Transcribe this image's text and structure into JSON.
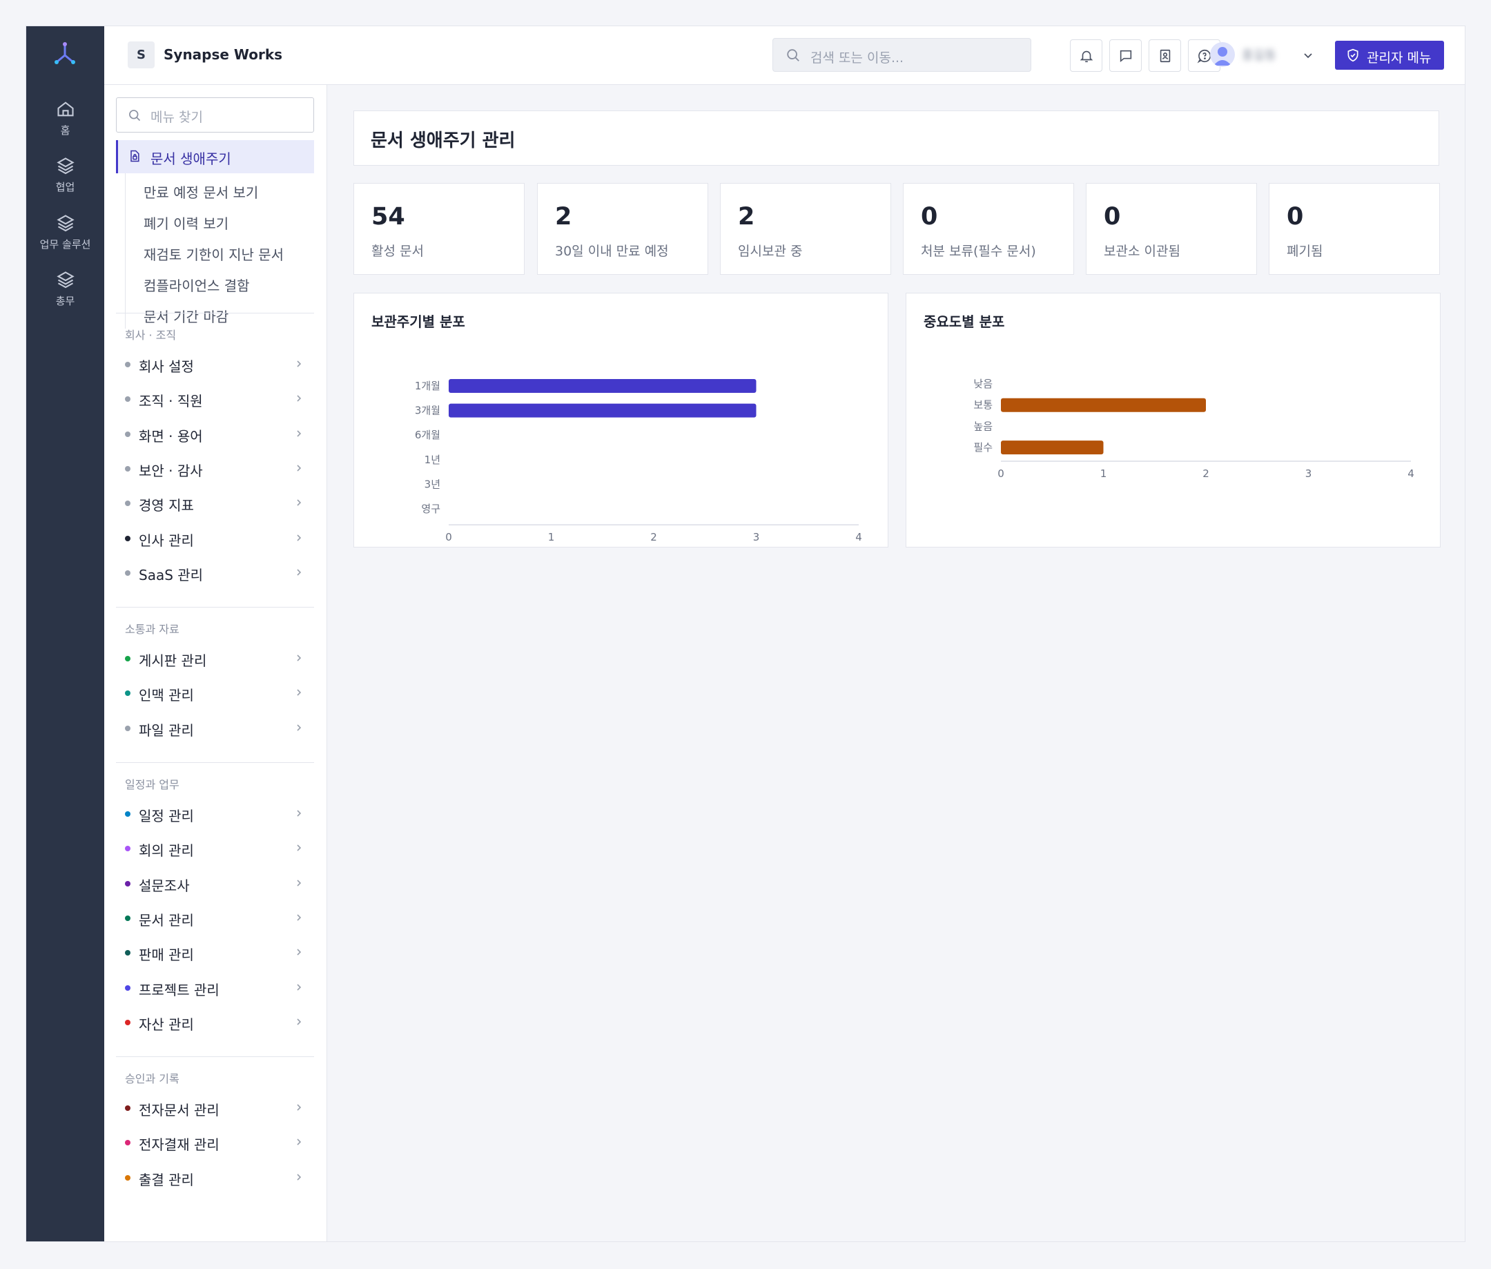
{
  "app": {
    "workspace_initial": "S",
    "workspace_name": "Synapse Works",
    "search_placeholder": "검색 또는 이동...",
    "admin_button": "관리자 메뉴",
    "user_name": "홍길동"
  },
  "rail": {
    "items": [
      {
        "label": "홈",
        "icon": "home-icon"
      },
      {
        "label": "협업",
        "icon": "layers-icon"
      },
      {
        "label": "업무 솔루션",
        "icon": "layers-icon"
      },
      {
        "label": "총무",
        "icon": "layers-icon"
      }
    ]
  },
  "sidebar": {
    "search_placeholder": "메뉴 찾기",
    "active": "문서 생애주기",
    "sub_items": [
      "만료 예정 문서 보기",
      "폐기 이력 보기",
      "재검토 기한이 지난 문서",
      "컴플라이언스 결함",
      "문서 기간 마감"
    ],
    "sections": [
      {
        "title": "회사 · 조직",
        "items": [
          {
            "label": "회사 설정",
            "color": "#9aa1ad"
          },
          {
            "label": "조직 · 직원",
            "color": "#9aa1ad"
          },
          {
            "label": "화면 · 용어",
            "color": "#9aa1ad"
          },
          {
            "label": "보안 · 감사",
            "color": "#9aa1ad"
          },
          {
            "label": "경영 지표",
            "color": "#9aa1ad"
          },
          {
            "label": "인사 관리",
            "color": "#1f2433"
          },
          {
            "label": "SaaS 관리",
            "color": "#9aa1ad"
          }
        ]
      },
      {
        "title": "소통과 자료",
        "items": [
          {
            "label": "게시판 관리",
            "color": "#16a34a"
          },
          {
            "label": "인맥 관리",
            "color": "#0d9488"
          },
          {
            "label": "파일 관리",
            "color": "#9aa1ad"
          }
        ]
      },
      {
        "title": "일정과 업무",
        "items": [
          {
            "label": "일정 관리",
            "color": "#0284c7"
          },
          {
            "label": "회의 관리",
            "color": "#a855f7"
          },
          {
            "label": "설문조사",
            "color": "#6b21a8"
          },
          {
            "label": "문서 관리",
            "color": "#047857"
          },
          {
            "label": "판매 관리",
            "color": "#115e59"
          },
          {
            "label": "프로젝트 관리",
            "color": "#4f46e5"
          },
          {
            "label": "자산 관리",
            "color": "#dc2626"
          }
        ]
      },
      {
        "title": "승인과 기록",
        "items": [
          {
            "label": "전자문서 관리",
            "color": "#7f1d1d"
          },
          {
            "label": "전자결재 관리",
            "color": "#db2777"
          },
          {
            "label": "출결 관리",
            "color": "#d97706"
          }
        ]
      }
    ]
  },
  "main": {
    "page_title": "문서 생애주기 관리",
    "stats": [
      {
        "value": "54",
        "label": "활성 문서"
      },
      {
        "value": "2",
        "label": "30일 이내 만료 예정"
      },
      {
        "value": "2",
        "label": "임시보관 중"
      },
      {
        "value": "0",
        "label": "처분 보류(필수 문서)"
      },
      {
        "value": "0",
        "label": "보관소 이관됨"
      },
      {
        "value": "0",
        "label": "폐기됨"
      }
    ]
  },
  "chart_data": [
    {
      "type": "bar",
      "orientation": "horizontal",
      "title": "보관주기별 분포",
      "categories": [
        "1개월",
        "3개월",
        "6개월",
        "1년",
        "3년",
        "영구"
      ],
      "values": [
        3,
        3,
        0,
        0,
        0,
        0
      ],
      "xlim": [
        0,
        4
      ],
      "xticks": [
        0,
        1,
        2,
        3,
        4
      ],
      "color": "#4338ca"
    },
    {
      "type": "bar",
      "orientation": "horizontal",
      "title": "중요도별 분포",
      "categories": [
        "낮음",
        "보통",
        "높음",
        "필수"
      ],
      "values": [
        0,
        2,
        0,
        1
      ],
      "xlim": [
        0,
        4
      ],
      "xticks": [
        0,
        1,
        2,
        3,
        4
      ],
      "color": "#b45309"
    }
  ]
}
